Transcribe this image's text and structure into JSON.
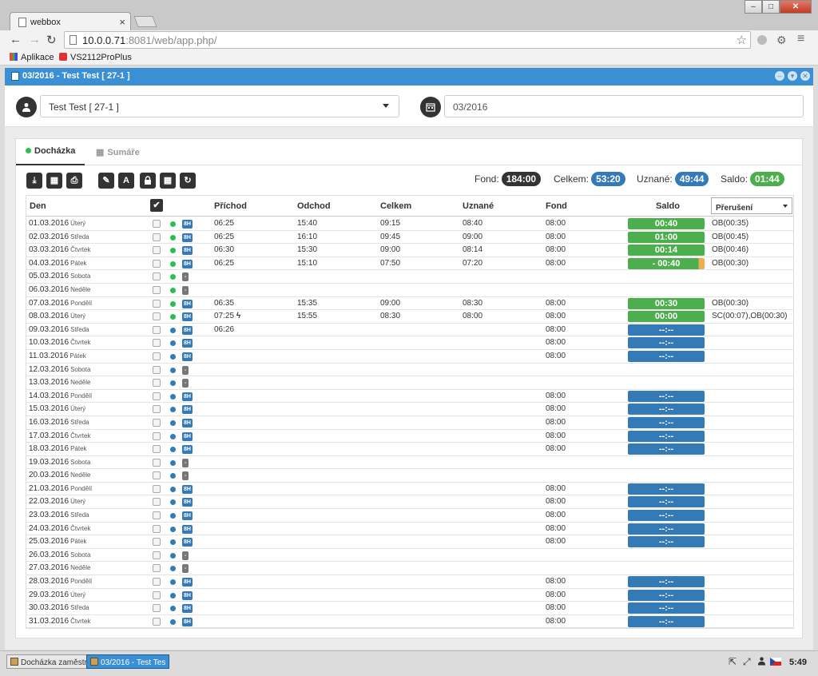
{
  "browser": {
    "tab_title": "webbox",
    "tab_close": "×",
    "url_host": "10.0.0.71",
    "url_rest": ":8081/web/app.php/",
    "bookmarks": [
      {
        "label": "Aplikace",
        "icon": "apps-grid-icon"
      },
      {
        "label": "VS2112ProPlus",
        "icon": "red-square-icon"
      }
    ]
  },
  "window_buttons": {
    "minimize": "–",
    "maximize": "□",
    "close": "✕"
  },
  "app": {
    "title": "03/2016 - Test Test [ 27-1 ]",
    "accent": "#3a8fd5"
  },
  "filters": {
    "employee_value": "Test Test [ 27-1 ]",
    "period_value": "03/2016"
  },
  "tabs": {
    "attendance": "Docházka",
    "summaries": "Sumáře"
  },
  "icons": {
    "user": "👤",
    "calendar": "▦",
    "grid": "▦",
    "arrow_back": "←",
    "arrow_forward": "→",
    "reload": "↻",
    "star": "☆",
    "menu": "≡",
    "chevron_down": "▾",
    "check": "✔",
    "download": "⤓",
    "calculator": "▦",
    "print": "⎙",
    "pencil": "✎",
    "font": "A",
    "lock": "🔒",
    "refresh": "↻",
    "lightning": "ϟ"
  },
  "stats": {
    "fond_label": "Fond:",
    "fond_value": "184:00",
    "celkem_label": "Celkem:",
    "celkem_value": "53:20",
    "uznane_label": "Uznané:",
    "uznane_value": "49:44",
    "saldo_label": "Saldo:",
    "saldo_value": "01:44"
  },
  "table": {
    "headers": {
      "day": "Den",
      "arrival": "Příchod",
      "departure": "Odchod",
      "total": "Celkem",
      "recognized": "Uznané",
      "fund": "Fond",
      "saldo": "Saldo",
      "interruption": "Přerušení"
    },
    "rows": [
      {
        "date": "01.03.2016",
        "wd": "Úterý",
        "dot": "green",
        "type": "8H",
        "in": "06:25",
        "out": "15:40",
        "tot": "09:15",
        "rec": "08:40",
        "fond": "08:00",
        "saldo": "00:40",
        "sc": "green",
        "int": "OB(00:35)"
      },
      {
        "date": "02.03.2016",
        "wd": "Středa",
        "dot": "green",
        "type": "8H",
        "in": "06:25",
        "out": "16:10",
        "tot": "09:45",
        "rec": "09:00",
        "fond": "08:00",
        "saldo": "01:00",
        "sc": "green",
        "int": "OB(00:45)"
      },
      {
        "date": "03.03.2016",
        "wd": "Čtvrtek",
        "dot": "green",
        "type": "8H",
        "in": "06:30",
        "out": "15:30",
        "tot": "09:00",
        "rec": "08:14",
        "fond": "08:00",
        "saldo": "00:14",
        "sc": "green",
        "int": "OB(00:46)"
      },
      {
        "date": "04.03.2016",
        "wd": "Pátek",
        "dot": "green",
        "type": "8H",
        "in": "06:25",
        "out": "15:10",
        "tot": "07:50",
        "rec": "07:20",
        "fond": "08:00",
        "saldo": "- 00:40",
        "sc": "green-warn",
        "int": "OB(00:30)"
      },
      {
        "date": "05.03.2016",
        "wd": "Sobota",
        "dot": "green",
        "type": "-",
        "in": "",
        "out": "",
        "tot": "",
        "rec": "",
        "fond": "",
        "saldo": "",
        "sc": "",
        "int": ""
      },
      {
        "date": "06.03.2016",
        "wd": "Neděle",
        "dot": "green",
        "type": "-",
        "in": "",
        "out": "",
        "tot": "",
        "rec": "",
        "fond": "",
        "saldo": "",
        "sc": "",
        "int": ""
      },
      {
        "date": "07.03.2016",
        "wd": "Pondělí",
        "dot": "green",
        "type": "8H",
        "in": "06:35",
        "out": "15:35",
        "tot": "09:00",
        "rec": "08:30",
        "fond": "08:00",
        "saldo": "00:30",
        "sc": "green",
        "int": "OB(00:30)"
      },
      {
        "date": "08.03.2016",
        "wd": "Úterý",
        "dot": "green",
        "type": "8H",
        "in": "07:25",
        "bolt": true,
        "out": "15:55",
        "tot": "08:30",
        "rec": "08:00",
        "fond": "08:00",
        "saldo": "00:00",
        "sc": "green",
        "int": "SC(00:07),OB(00:30)"
      },
      {
        "date": "09.03.2016",
        "wd": "Středa",
        "dot": "blue",
        "type": "8H",
        "in": "06:26",
        "out": "",
        "tot": "",
        "rec": "",
        "fond": "08:00",
        "saldo": "--:--",
        "sc": "blue",
        "int": ""
      },
      {
        "date": "10.03.2016",
        "wd": "Čtvrtek",
        "dot": "blue",
        "type": "8H",
        "in": "",
        "out": "",
        "tot": "",
        "rec": "",
        "fond": "08:00",
        "saldo": "--:--",
        "sc": "blue",
        "int": ""
      },
      {
        "date": "11.03.2016",
        "wd": "Pátek",
        "dot": "blue",
        "type": "8H",
        "in": "",
        "out": "",
        "tot": "",
        "rec": "",
        "fond": "08:00",
        "saldo": "--:--",
        "sc": "blue",
        "int": ""
      },
      {
        "date": "12.03.2016",
        "wd": "Sobota",
        "dot": "blue",
        "type": "-",
        "in": "",
        "out": "",
        "tot": "",
        "rec": "",
        "fond": "",
        "saldo": "",
        "sc": "",
        "int": ""
      },
      {
        "date": "13.03.2016",
        "wd": "Neděle",
        "dot": "blue",
        "type": "-",
        "in": "",
        "out": "",
        "tot": "",
        "rec": "",
        "fond": "",
        "saldo": "",
        "sc": "",
        "int": ""
      },
      {
        "date": "14.03.2016",
        "wd": "Pondělí",
        "dot": "blue",
        "type": "8H",
        "in": "",
        "out": "",
        "tot": "",
        "rec": "",
        "fond": "08:00",
        "saldo": "--:--",
        "sc": "blue",
        "int": ""
      },
      {
        "date": "15.03.2016",
        "wd": "Úterý",
        "dot": "blue",
        "type": "8H",
        "in": "",
        "out": "",
        "tot": "",
        "rec": "",
        "fond": "08:00",
        "saldo": "--:--",
        "sc": "blue",
        "int": ""
      },
      {
        "date": "16.03.2016",
        "wd": "Středa",
        "dot": "blue",
        "type": "8H",
        "in": "",
        "out": "",
        "tot": "",
        "rec": "",
        "fond": "08:00",
        "saldo": "--:--",
        "sc": "blue",
        "int": ""
      },
      {
        "date": "17.03.2016",
        "wd": "Čtvrtek",
        "dot": "blue",
        "type": "8H",
        "in": "",
        "out": "",
        "tot": "",
        "rec": "",
        "fond": "08:00",
        "saldo": "--:--",
        "sc": "blue",
        "int": ""
      },
      {
        "date": "18.03.2016",
        "wd": "Pátek",
        "dot": "blue",
        "type": "8H",
        "in": "",
        "out": "",
        "tot": "",
        "rec": "",
        "fond": "08:00",
        "saldo": "--:--",
        "sc": "blue",
        "int": ""
      },
      {
        "date": "19.03.2016",
        "wd": "Sobota",
        "dot": "blue",
        "type": "-",
        "in": "",
        "out": "",
        "tot": "",
        "rec": "",
        "fond": "",
        "saldo": "",
        "sc": "",
        "int": ""
      },
      {
        "date": "20.03.2016",
        "wd": "Neděle",
        "dot": "blue",
        "type": "-",
        "in": "",
        "out": "",
        "tot": "",
        "rec": "",
        "fond": "",
        "saldo": "",
        "sc": "",
        "int": ""
      },
      {
        "date": "21.03.2016",
        "wd": "Pondělí",
        "dot": "blue",
        "type": "8H",
        "in": "",
        "out": "",
        "tot": "",
        "rec": "",
        "fond": "08:00",
        "saldo": "--:--",
        "sc": "blue",
        "int": ""
      },
      {
        "date": "22.03.2016",
        "wd": "Úterý",
        "dot": "blue",
        "type": "8H",
        "in": "",
        "out": "",
        "tot": "",
        "rec": "",
        "fond": "08:00",
        "saldo": "--:--",
        "sc": "blue",
        "int": ""
      },
      {
        "date": "23.03.2016",
        "wd": "Středa",
        "dot": "blue",
        "type": "8H",
        "in": "",
        "out": "",
        "tot": "",
        "rec": "",
        "fond": "08:00",
        "saldo": "--:--",
        "sc": "blue",
        "int": ""
      },
      {
        "date": "24.03.2016",
        "wd": "Čtvrtek",
        "dot": "blue",
        "type": "8H",
        "in": "",
        "out": "",
        "tot": "",
        "rec": "",
        "fond": "08:00",
        "saldo": "--:--",
        "sc": "blue",
        "int": ""
      },
      {
        "date": "25.03.2016",
        "wd": "Pátek",
        "dot": "blue",
        "type": "8H",
        "in": "",
        "out": "",
        "tot": "",
        "rec": "",
        "fond": "08:00",
        "saldo": "--:--",
        "sc": "blue",
        "int": ""
      },
      {
        "date": "26.03.2016",
        "wd": "Sobota",
        "dot": "blue",
        "type": "-",
        "in": "",
        "out": "",
        "tot": "",
        "rec": "",
        "fond": "",
        "saldo": "",
        "sc": "",
        "int": ""
      },
      {
        "date": "27.03.2016",
        "wd": "Neděle",
        "dot": "blue",
        "type": "-",
        "in": "",
        "out": "",
        "tot": "",
        "rec": "",
        "fond": "",
        "saldo": "",
        "sc": "",
        "int": ""
      },
      {
        "date": "28.03.2016",
        "wd": "Pondělí",
        "dot": "blue",
        "type": "8H",
        "in": "",
        "out": "",
        "tot": "",
        "rec": "",
        "fond": "08:00",
        "saldo": "--:--",
        "sc": "blue",
        "int": ""
      },
      {
        "date": "29.03.2016",
        "wd": "Úterý",
        "dot": "blue",
        "type": "8H",
        "in": "",
        "out": "",
        "tot": "",
        "rec": "",
        "fond": "08:00",
        "saldo": "--:--",
        "sc": "blue",
        "int": ""
      },
      {
        "date": "30.03.2016",
        "wd": "Středa",
        "dot": "blue",
        "type": "8H",
        "in": "",
        "out": "",
        "tot": "",
        "rec": "",
        "fond": "08:00",
        "saldo": "--:--",
        "sc": "blue",
        "int": ""
      },
      {
        "date": "31.03.2016",
        "wd": "Čtvrtek",
        "dot": "blue",
        "type": "8H",
        "in": "",
        "out": "",
        "tot": "",
        "rec": "",
        "fond": "08:00",
        "saldo": "--:--",
        "sc": "blue",
        "int": ""
      }
    ]
  },
  "colors": {
    "green": "#2ebd4e",
    "saldo_green": "#4cae4c",
    "blue": "#337ab7",
    "warn": "#f0ad4e",
    "dark": "#333333",
    "weekend": "#777777"
  },
  "taskbar": {
    "items": [
      {
        "label": "Docházka zaměstn"
      },
      {
        "label": "03/2016 - Test Tes"
      }
    ],
    "clock": "5:49"
  }
}
